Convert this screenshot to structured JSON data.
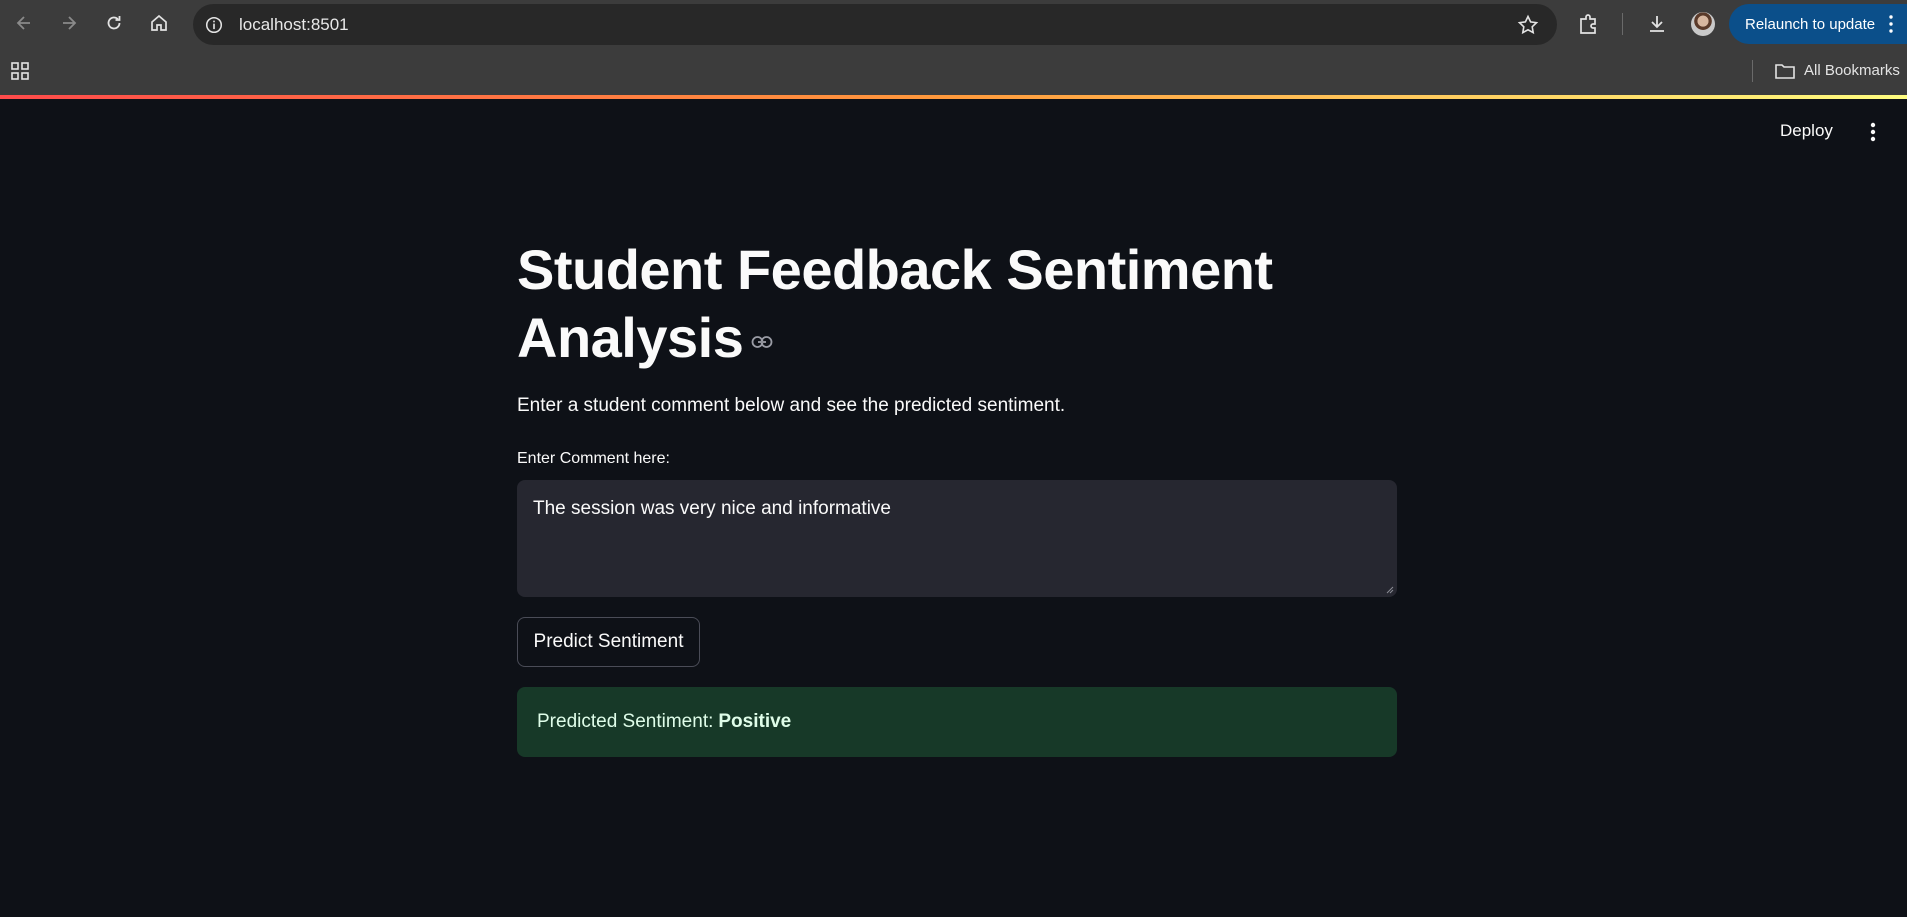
{
  "browser": {
    "url": "localhost:8501",
    "relaunch_label": "Relaunch to update",
    "all_bookmarks_label": "All Bookmarks",
    "relaunch_color": "#0b4f8a"
  },
  "header": {
    "deploy_label": "Deploy"
  },
  "main": {
    "title_line1": "Student Feedback Sentiment",
    "title_line2": "Analysis",
    "subtitle": "Enter a student comment below and see the predicted sentiment.",
    "comment_label": "Enter Comment here:",
    "comment_value": "The session was very nice and informative",
    "predict_button_label": "Predict Sentiment",
    "result_prefix": "Predicted Sentiment:",
    "result_value": "Positive",
    "result_bg_color": "#173928"
  }
}
